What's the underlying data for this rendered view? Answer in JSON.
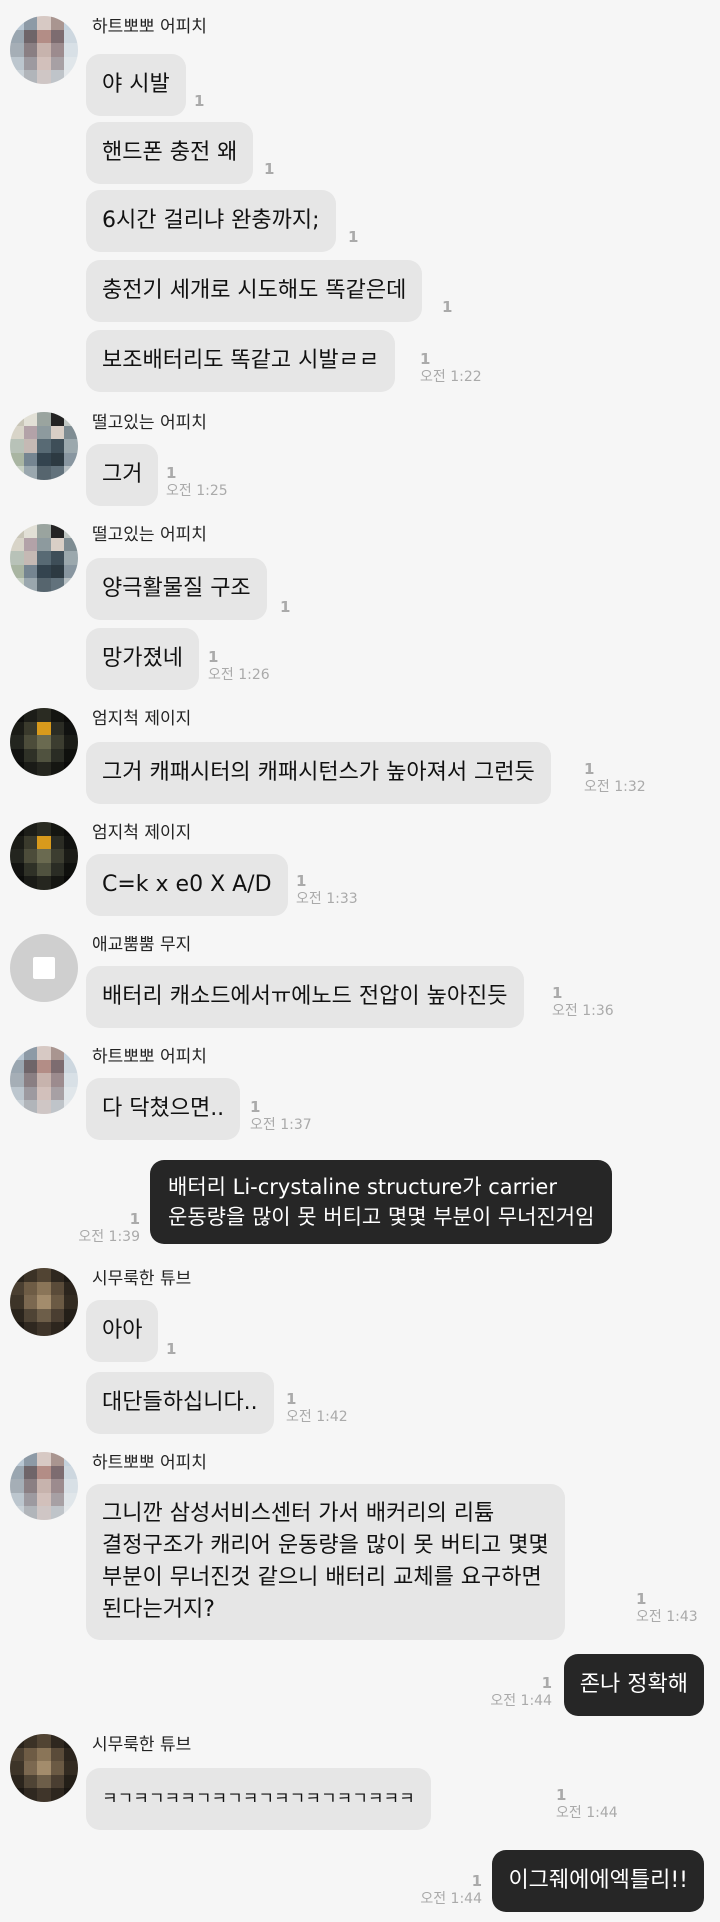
{
  "conversation": [
    {
      "sender": "하트뽀뽀 어피치",
      "avatar": "pixel-avatar-1",
      "messages": [
        {
          "text": "야 시발",
          "count": "1",
          "time": ""
        },
        {
          "text": "핸드폰 충전 왜",
          "count": "1",
          "time": ""
        },
        {
          "text": "6시간 걸리냐 완충까지;",
          "count": "1",
          "time": ""
        },
        {
          "text": "충전기 세개로 시도해도 똑같은데",
          "count": "1",
          "time": ""
        },
        {
          "text": "보조배터리도 똑같고 시발ㄹㄹ",
          "count": "1",
          "time": "오전 1:22"
        }
      ]
    },
    {
      "sender": "떨고있는 어피치",
      "avatar": "pixel-avatar-2",
      "messages": [
        {
          "text": "그거",
          "count": "1",
          "time": "오전 1:25"
        }
      ]
    },
    {
      "sender": "떨고있는 어피치",
      "avatar": "pixel-avatar-2",
      "messages": [
        {
          "text": "양극활물질 구조",
          "count": "1",
          "time": ""
        },
        {
          "text": "망가졌네",
          "count": "1",
          "time": "오전 1:26"
        }
      ]
    },
    {
      "sender": "엄지척 제이지",
      "avatar": "pixel-avatar-3",
      "messages": [
        {
          "text": "그거 캐패시터의 캐패시턴스가 높아져서 그런듯",
          "count": "1",
          "time": "오전 1:32"
        }
      ]
    },
    {
      "sender": "엄지척 제이지",
      "avatar": "pixel-avatar-3",
      "messages": [
        {
          "text": "C=k x e0 X A/D",
          "count": "1",
          "time": "오전 1:33"
        }
      ]
    },
    {
      "sender": "애교뿜뿜 무지",
      "avatar": "default-avatar",
      "messages": [
        {
          "text": "배터리 캐소드에서ㅠ에노드 전압이 높아진듯",
          "count": "1",
          "time": "오전 1:36"
        }
      ]
    },
    {
      "sender": "하트뽀뽀 어피치",
      "avatar": "pixel-avatar-1",
      "messages": [
        {
          "text": "다 닥쳤으면..",
          "count": "1",
          "time": "오전 1:37"
        }
      ]
    },
    {
      "sender": "",
      "mine": true,
      "messages": [
        {
          "text": "배터리 Li-crystaline structure가 carrier\n운동량을 많이 못 버티고 몇몇 부분이 무너진거임",
          "count": "1",
          "time": "오전 1:39"
        }
      ]
    },
    {
      "sender": "시무룩한 튜브",
      "avatar": "pixel-avatar-4",
      "messages": [
        {
          "text": "아아",
          "count": "1",
          "time": ""
        },
        {
          "text": "대단들하십니다..",
          "count": "1",
          "time": "오전 1:42"
        }
      ]
    },
    {
      "sender": "하트뽀뽀 어피치",
      "avatar": "pixel-avatar-1",
      "messages": [
        {
          "text": "그니깐 삼성서비스센터 가서 배커리의 리튬\n결정구조가 캐리어 운동량을 많이 못 버티고 몇몇\n부분이 무너진것 같으니 배터리 교체를 요구하면\n된다는거지?",
          "count": "1",
          "time": "오전 1:43"
        }
      ]
    },
    {
      "sender": "",
      "mine": true,
      "messages": [
        {
          "text": "존나 정확해",
          "count": "1",
          "time": "오전 1:44"
        }
      ]
    },
    {
      "sender": "시무룩한 튜브",
      "avatar": "pixel-avatar-4",
      "messages": [
        {
          "text": "ㅋㄱㅋㄱㅋㅋㄱㅋㄱㅋㄱㅋㄱㅋㄱㅋㄱㅋㅋㅋ",
          "count": "1",
          "time": "오전 1:44"
        }
      ]
    },
    {
      "sender": "",
      "mine": true,
      "messages": [
        {
          "text": "이그줴에에엑틀리!!",
          "count": "1",
          "time": "오전 1:44"
        }
      ]
    }
  ],
  "avatar_palettes": {
    "pixel-avatar-1": [
      "#b9c7d3",
      "#8d9aa6",
      "#d7c9c4",
      "#a99590",
      "#c4d2dd",
      "#9aa6b0",
      "#6f6569",
      "#b38d86",
      "#7d6c70",
      "#cdd7df",
      "#a5aeb6",
      "#8a7f83",
      "#c7b3ad",
      "#9c8b8e",
      "#d8e0e6",
      "#bcc6ce",
      "#9d9aa0",
      "#d2c0bb",
      "#a7a0a4",
      "#e0e6ea",
      "#c9d1d7",
      "#b1b5ba",
      "#cfc6c5",
      "#bfc4c9",
      "#e4e8eb"
    ],
    "pixel-avatar-2": [
      "#c9c6b8",
      "#e2e0d6",
      "#9aa49f",
      "#232323",
      "#bfc6c2",
      "#d8d4c8",
      "#b3a2a8",
      "#8d9a9e",
      "#d9cfc6",
      "#7e8c92",
      "#b8c2b8",
      "#c5b9b4",
      "#586a74",
      "#3e4e58",
      "#9ba8ad",
      "#a9b5a2",
      "#758591",
      "#34444f",
      "#2d3a42",
      "#8896a0",
      "#c7d0c4",
      "#9aa7ae",
      "#56656e",
      "#62727c",
      "#b7c0c4"
    ],
    "pixel-avatar-3": [
      "#0e0e0c",
      "#1c1d18",
      "#2a2b22",
      "#141511",
      "#0c0c0a",
      "#1a1b16",
      "#3a3a2c",
      "#d89a1c",
      "#2b2c24",
      "#111210",
      "#23251f",
      "#4c4c3a",
      "#6a6a50",
      "#3c3d30",
      "#1b1c17",
      "#121311",
      "#2f3127",
      "#50523f",
      "#2a2c24",
      "#0f100d",
      "#0b0c0a",
      "#1a1b17",
      "#25261f",
      "#151612",
      "#0a0a09"
    ],
    "pixel-avatar-4": [
      "#2a241c",
      "#3b3226",
      "#514433",
      "#2e271f",
      "#1d1914",
      "#4a3f31",
      "#6e5c45",
      "#8a7558",
      "#5a4b39",
      "#2c251d",
      "#3d3428",
      "#7b6850",
      "#a38c6c",
      "#6b5a44",
      "#332b21",
      "#2b251d",
      "#4f4435",
      "#6d5e49",
      "#4a3e31",
      "#241f18",
      "#1c1813",
      "#2f2820",
      "#3f352a",
      "#2d261e",
      "#1a1612"
    ]
  }
}
